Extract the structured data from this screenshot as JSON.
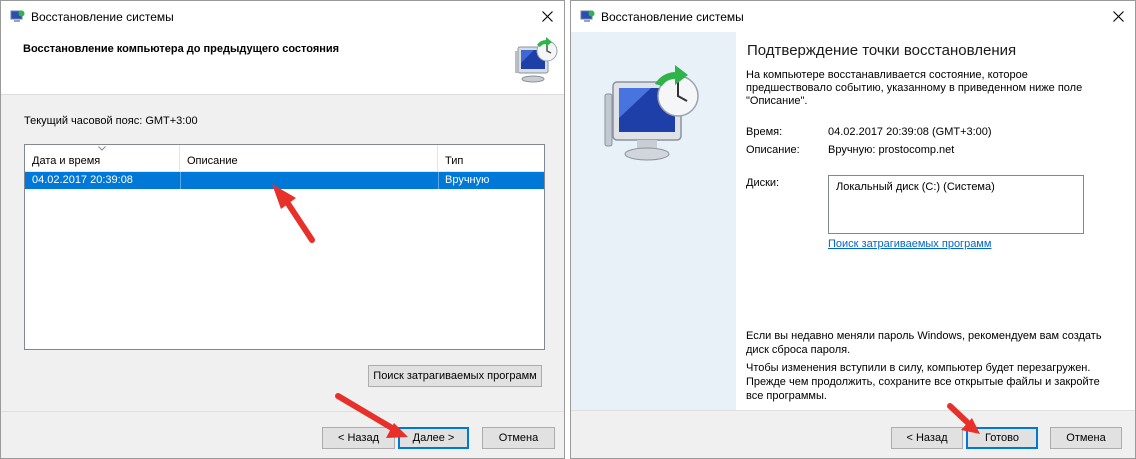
{
  "left_dialog": {
    "title": "Восстановление системы",
    "heading": "Восстановление компьютера до предыдущего состояния",
    "timezone": "Текущий часовой пояс: GMT+3:00",
    "columns": [
      "Дата и время",
      "Описание",
      "Тип"
    ],
    "rows": [
      {
        "date": "04.02.2017 20:39:08",
        "description": "",
        "type": "Вручную",
        "selected": true
      }
    ],
    "scan_button": "Поиск затрагиваемых программ",
    "back_button": "< Назад",
    "next_button": "Далее >",
    "cancel_button": "Отмена"
  },
  "right_dialog": {
    "title": "Восстановление системы",
    "heading": "Подтверждение точки восстановления",
    "intro": "На компьютере восстанавливается состояние, которое предшествовало событию, указанному в приведенном ниже поле \"Описание\".",
    "time_label": "Время:",
    "time_value": "04.02.2017 20:39:08 (GMT+3:00)",
    "description_label": "Описание:",
    "description_value": "Вручную: prostocomp.net",
    "disks_label": "Диски:",
    "disks_value": "Локальный диск (C:) (Система)",
    "scan_link": "Поиск затрагиваемых программ",
    "password_note": "Если вы недавно меняли пароль Windows, рекомендуем вам создать диск сброса пароля.",
    "restart_note": "Чтобы изменения вступили в силу, компьютер будет перезагружен. Прежде чем продолжить, сохраните все открытые файлы и закройте все программы.",
    "back_button": "< Назад",
    "finish_button": "Готово",
    "cancel_button": "Отмена"
  },
  "colors": {
    "selection": "#0078d7",
    "annotation_arrow": "#e8302a",
    "side_panel": "#e8f0f8",
    "link": "#0066cc"
  }
}
